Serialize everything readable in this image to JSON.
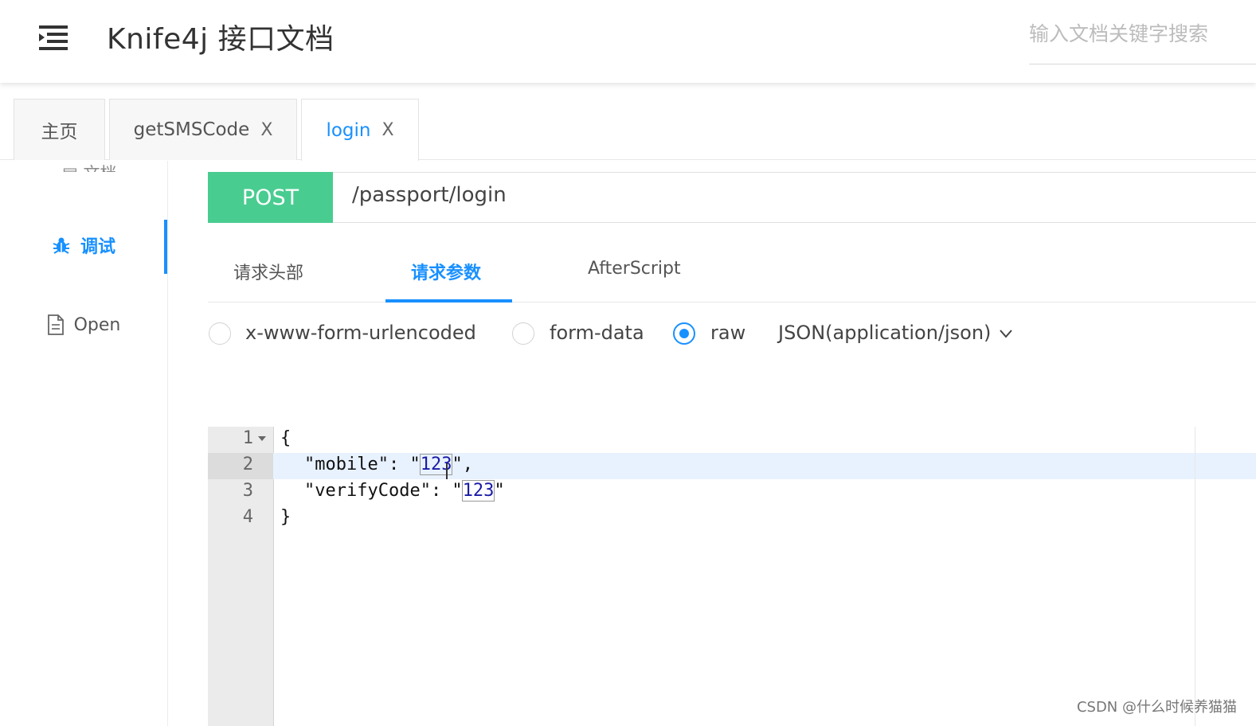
{
  "header": {
    "title": "Knife4j 接口文档",
    "search_placeholder": "输入文档关键字搜索"
  },
  "tabs": [
    {
      "label": "主页",
      "closable": false,
      "active": false
    },
    {
      "label": "getSMSCode",
      "closable": true,
      "active": false
    },
    {
      "label": "login",
      "closable": true,
      "active": true
    }
  ],
  "tab_close_glyph": "X",
  "sidebar": {
    "partial_label": "文档",
    "items": [
      {
        "label": "调试",
        "icon": "bug-icon",
        "active": true
      },
      {
        "label": "Open",
        "icon": "document-icon",
        "active": false
      }
    ]
  },
  "request": {
    "method": "POST",
    "method_color": "#49cc90",
    "path": "/passport/login"
  },
  "subtabs": [
    "请求头部",
    "请求参数",
    "AfterScript"
  ],
  "active_subtab": "请求参数",
  "body_types": [
    {
      "label": "x-www-form-urlencoded",
      "checked": false
    },
    {
      "label": "form-data",
      "checked": false
    },
    {
      "label": "raw",
      "checked": true
    }
  ],
  "content_type": "JSON(application/json)",
  "editor": {
    "line_numbers": [
      "1",
      "2",
      "3",
      "4"
    ],
    "lines": [
      "{",
      "\"mobile\": \"123\",",
      "\"verifyCode\": \"123\"",
      "}"
    ],
    "active_line": 2
  },
  "colors": {
    "accent": "#1890ff",
    "string": "#1a1aa6"
  },
  "watermark": "CSDN @什么时候养猫猫"
}
